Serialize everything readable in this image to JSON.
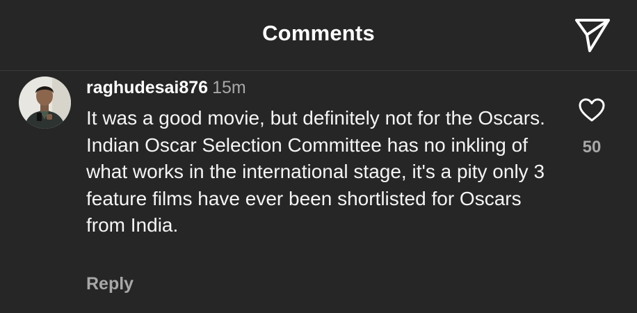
{
  "header": {
    "title": "Comments",
    "share_icon": "paper-plane-icon"
  },
  "comment": {
    "username": "raghudesai876",
    "time": "15m",
    "text": "It was a good movie, but definitely not for the Oscars. Indian Oscar Selection Committee has no inkling of what works in the international stage, it's a pity only 3 feature films have ever been shortlisted for Oscars from India.",
    "reply_label": "Reply",
    "like_icon": "heart-outline-icon",
    "like_count": "50"
  },
  "colors": {
    "background": "#262626",
    "primary_text": "#ffffff",
    "secondary_text": "#a8a8a8",
    "divider": "#3a3a3a"
  }
}
